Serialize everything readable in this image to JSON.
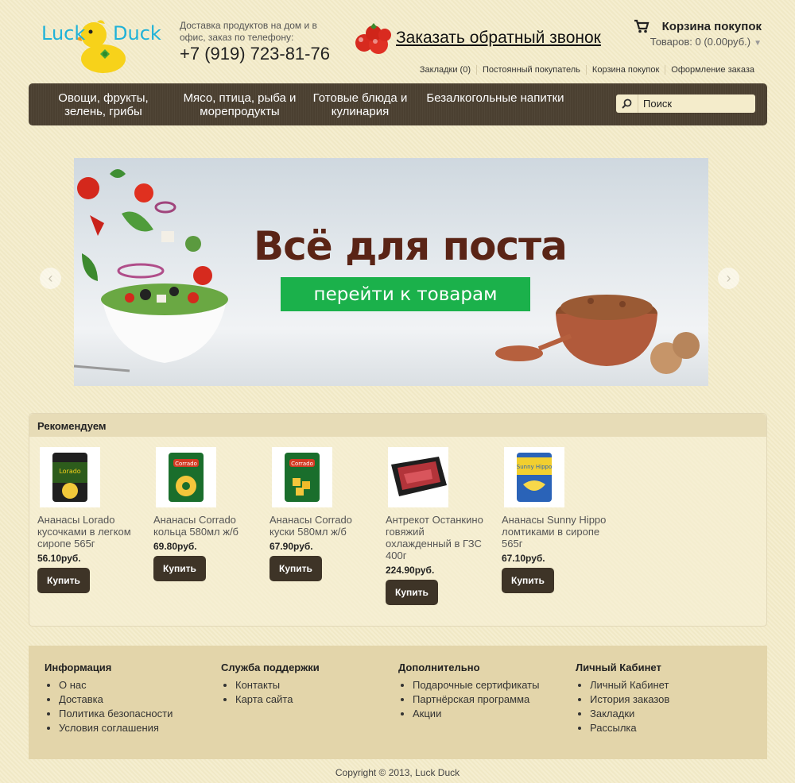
{
  "header": {
    "logo_word1": "Luck",
    "logo_word2": "Duck",
    "delivery_text": "Доставка продуктов на дом и в офис, заказ по телефону:",
    "phone": "+7 (919) 723-81-76",
    "callback_label": "Заказать обратный звонок",
    "cart_title": "Корзина покупок",
    "cart_count": "Товаров: 0 (0.00руб.)",
    "top_links": [
      "Закладки (0)",
      "Постоянный покупатель",
      "Корзина покупок",
      "Оформление заказа"
    ]
  },
  "menu": {
    "items": [
      "Овощи, фрукты, зелень, грибы",
      "Мясо, птица, рыба и морепродукты",
      "Готовые блюда и кулинария",
      "Безалкогольные напитки"
    ],
    "search_placeholder": "Поиск"
  },
  "banner": {
    "title": "Всё для поста",
    "button_label": "перейти к товарам"
  },
  "recommend": {
    "heading": "Рекомендуем",
    "buy_label": "Купить",
    "products": [
      {
        "name": "Ананасы Lorado кусочками в легком сиропе 565г",
        "price": "56.10руб.",
        "brand": "Lorado"
      },
      {
        "name": "Ананасы Corrado кольца 580мл ж/б",
        "price": "69.80руб.",
        "brand": "Corrado"
      },
      {
        "name": "Ананасы Corrado куски 580мл ж/б",
        "price": "67.90руб.",
        "brand": "Corrado"
      },
      {
        "name": "Антрекот Останкино говяжий охлажденный в ГЗС 400г",
        "price": "224.90руб.",
        "brand": ""
      },
      {
        "name": "Ананасы Sunny Hippo ломтиками в сиропе 565г",
        "price": "67.10руб.",
        "brand": "Sunny Hippo"
      }
    ]
  },
  "footer": {
    "columns": [
      {
        "title": "Информация",
        "links": [
          "О нас",
          "Доставка",
          "Политика безопасности",
          "Условия соглашения"
        ]
      },
      {
        "title": "Служба поддержки",
        "links": [
          "Контакты",
          "Карта сайта"
        ]
      },
      {
        "title": "Дополнительно",
        "links": [
          "Подарочные сертификаты",
          "Партнёрская программа",
          "Акции"
        ]
      },
      {
        "title": "Личный Кабинет",
        "links": [
          "Личный Кабинет",
          "История заказов",
          "Закладки",
          "Рассылка"
        ]
      }
    ],
    "copyright": "Copyright © 2013, Luck Duck"
  },
  "colors": {
    "background": "#f4ecc9",
    "menu_bg": "#4b4031",
    "accent_green": "#1bb14b",
    "logo_blue": "#1fb2d8",
    "button_dark": "#3e3427"
  }
}
